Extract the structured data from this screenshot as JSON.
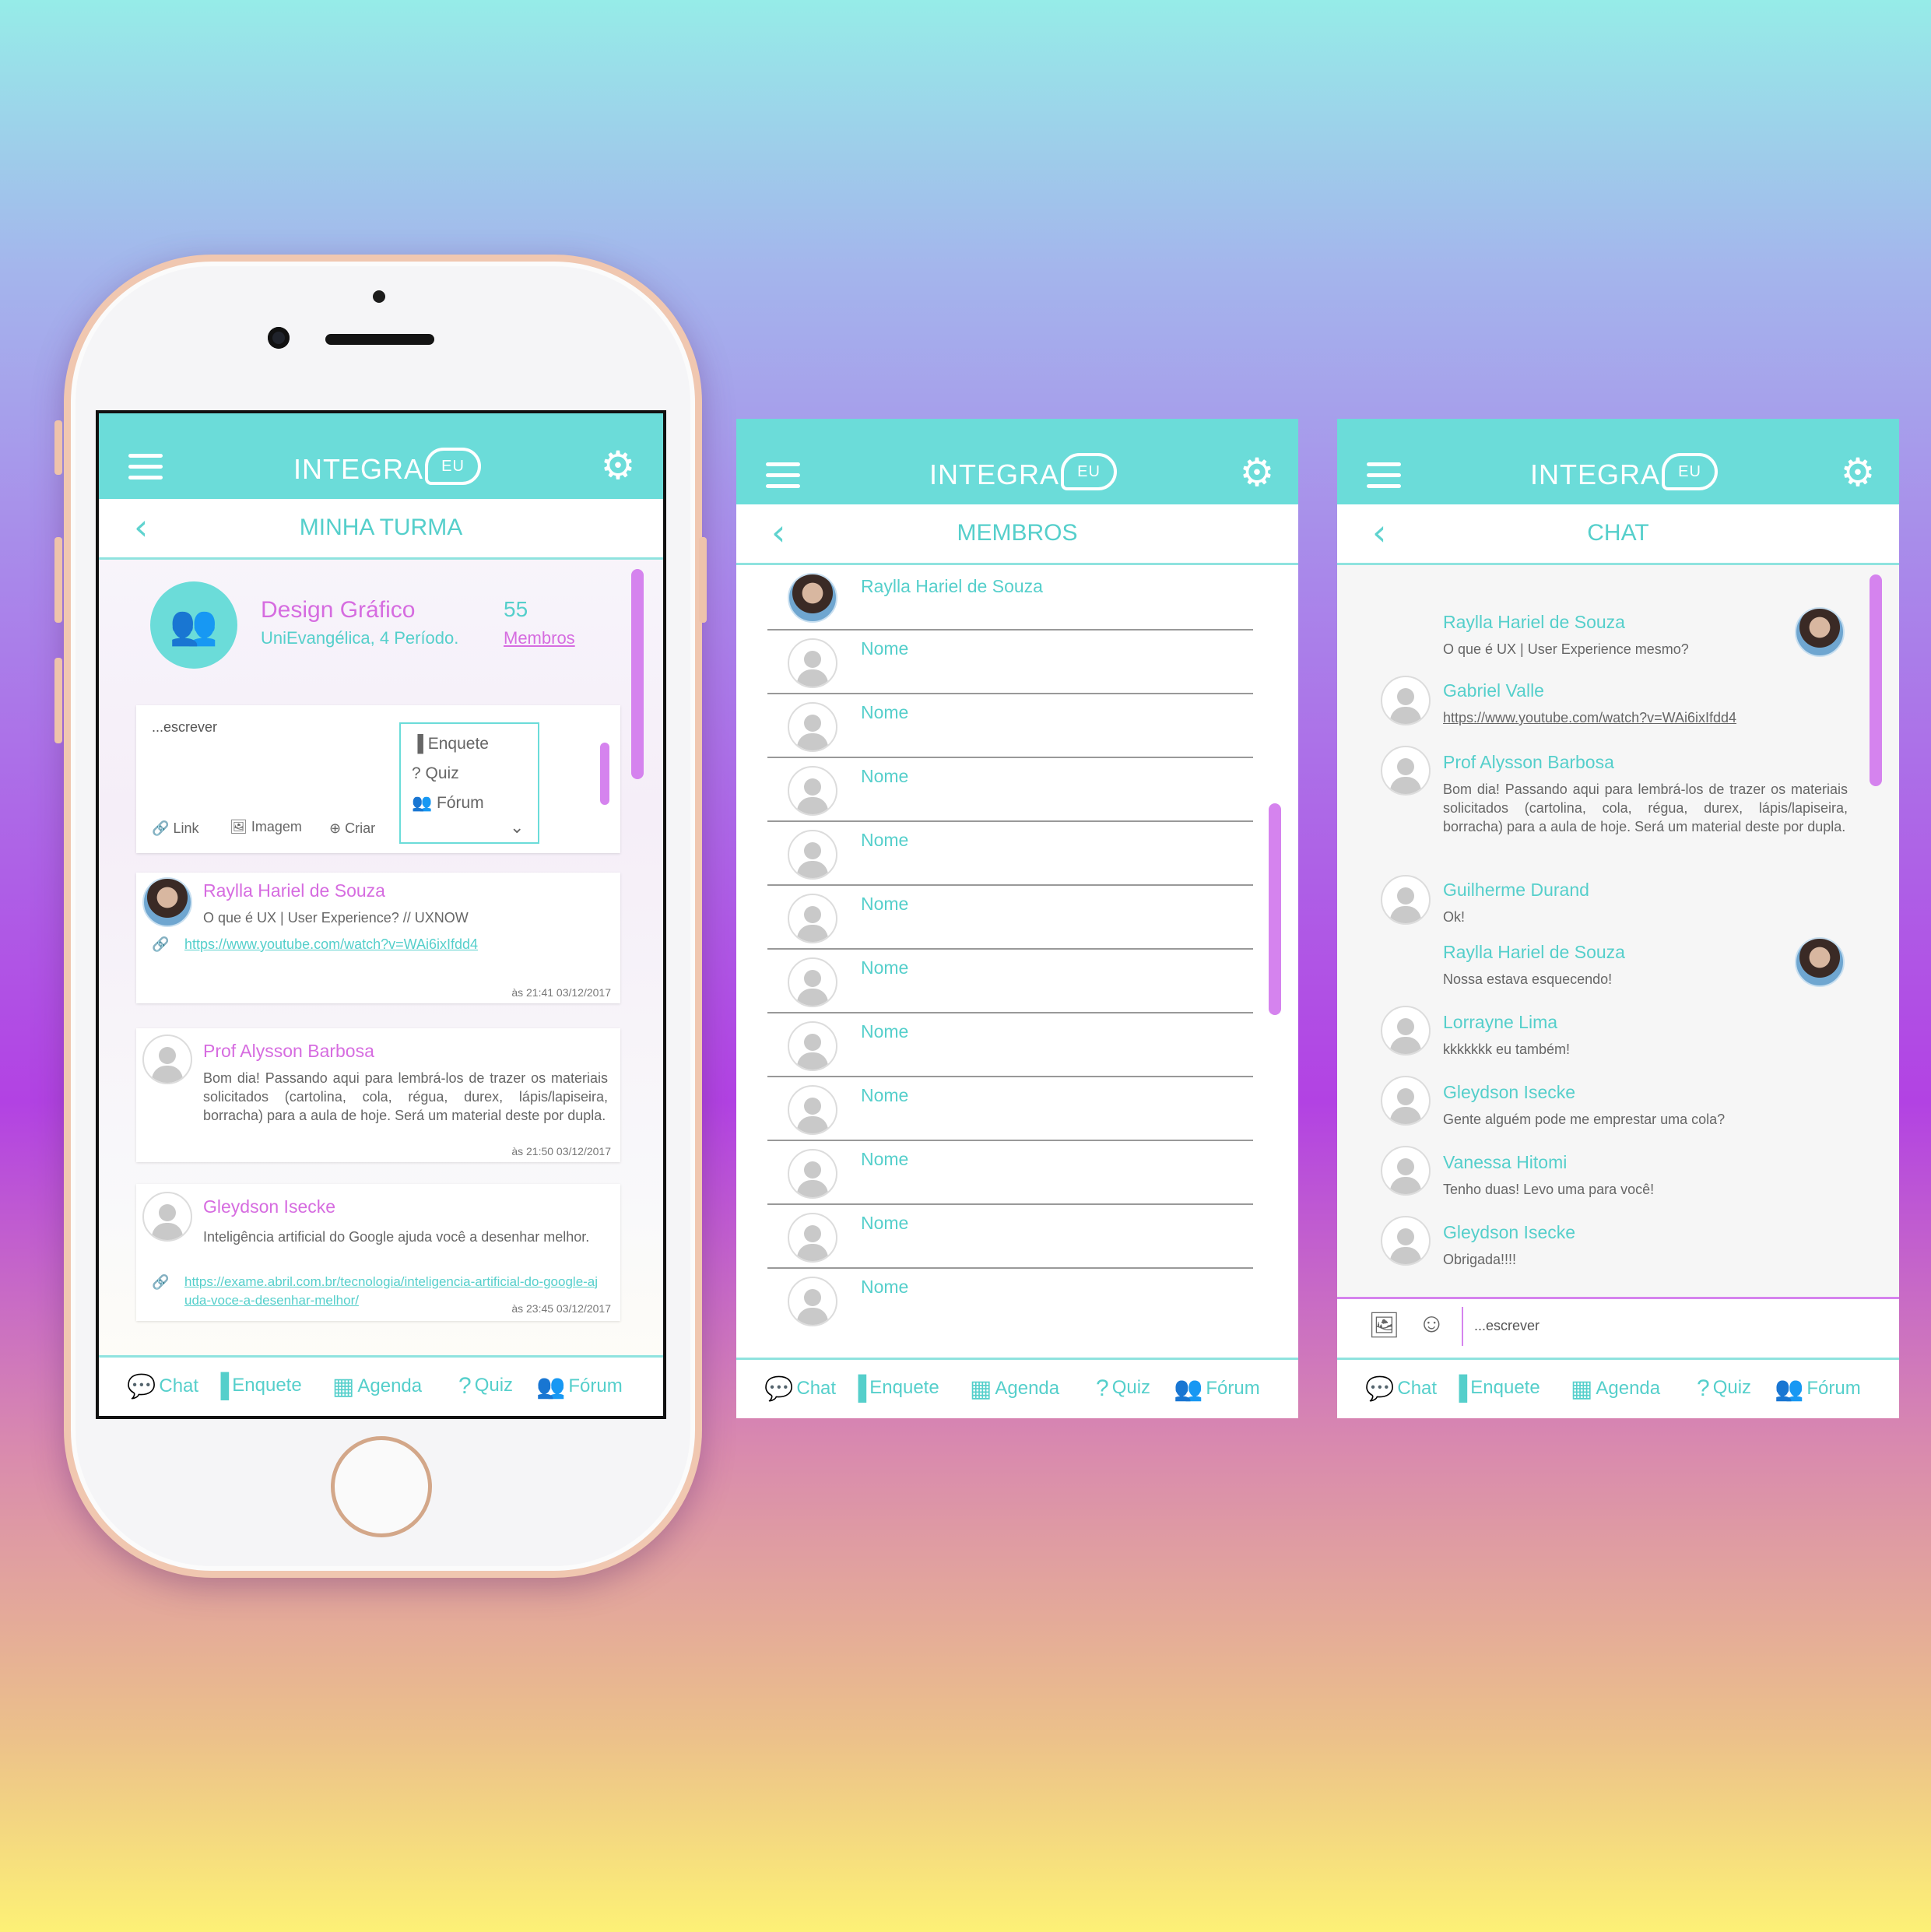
{
  "app": {
    "logo_text": "INTEGRA",
    "logo_bubble": "EU"
  },
  "screens": {
    "turma": {
      "title": "MINHA TURMA",
      "group": {
        "name": "Design Gráfico",
        "school": "UniEvangélica, 4 Período.",
        "count": "55",
        "count_label": "Membros"
      },
      "composer": {
        "placeholder": "...escrever",
        "link_label": "Link",
        "image_label": "Imagem",
        "create_label": "Criar",
        "menu": [
          "Enquete",
          "Quiz",
          "Fórum"
        ]
      },
      "posts": [
        {
          "author": "Raylla Hariel de Souza",
          "text": "O que é UX | User Experience? // UXNOW",
          "link": "https://www.youtube.com/watch?v=WAi6ixIfdd4",
          "time": "às 21:41  03/12/2017"
        },
        {
          "author": "Prof Alysson Barbosa",
          "text": "Bom dia! Passando aqui para lembrá-los de trazer os materiais solicitados (cartolina, cola, régua, durex, lápis/lapiseira, borracha) para a aula de hoje. Será um material deste por dupla.",
          "time": "às 21:50  03/12/2017"
        },
        {
          "author": "Gleydson Isecke",
          "text": "Inteligência artificial do Google ajuda você a desenhar melhor.",
          "link": "https://exame.abril.com.br/tecnologia/inteligencia-artificial-do-google-ajuda-voce-a-desenhar-melhor/",
          "time": "às 23:45 03/12/2017"
        }
      ]
    },
    "membros": {
      "title": "MEMBROS",
      "members": [
        "Raylla Hariel de Souza",
        "Nome",
        "Nome",
        "Nome",
        "Nome",
        "Nome",
        "Nome",
        "Nome",
        "Nome",
        "Nome",
        "Nome",
        "Nome"
      ]
    },
    "chat": {
      "title": "CHAT",
      "messages": [
        {
          "author": "Raylla Hariel de Souza",
          "text": "O que é UX | User Experience mesmo?"
        },
        {
          "author": "Gabriel Valle",
          "text": "https://www.youtube.com/watch?v=WAi6ixIfdd4"
        },
        {
          "author": "Prof Alysson Barbosa",
          "text": "Bom dia! Passando aqui para lembrá-los de trazer os materiais solicitados (cartolina, cola, régua, durex, lápis/lapiseira, borracha) para a aula de hoje. Será um material deste por dupla."
        },
        {
          "author": "Guilherme Durand",
          "text": "Ok!"
        },
        {
          "author": "Raylla Hariel de Souza",
          "text": "Nossa estava esquecendo!"
        },
        {
          "author": "Lorrayne Lima",
          "text": "kkkkkkk eu também!"
        },
        {
          "author": "Gleydson Isecke",
          "text": "Gente alguém pode me emprestar uma cola?"
        },
        {
          "author": "Vanessa Hitomi",
          "text": "Tenho duas! Levo uma para você!"
        },
        {
          "author": "Gleydson Isecke",
          "text": "Obrigada!!!!"
        }
      ],
      "input_placeholder": "...escrever"
    }
  },
  "tabbar": [
    "Chat",
    "Enquete",
    "Agenda",
    "Quiz",
    "Fórum"
  ],
  "colors": {
    "teal": "#6bdcd9",
    "teal_text": "#55cfcb",
    "purple": "#d66ce0",
    "scroll": "#d583ee"
  }
}
